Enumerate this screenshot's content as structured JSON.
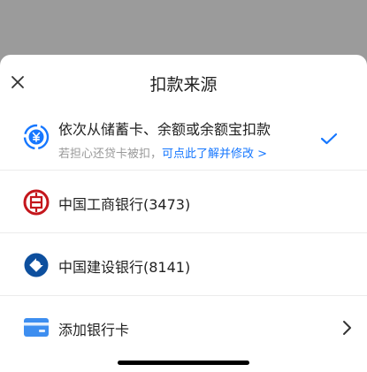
{
  "sheet": {
    "title": "扣款来源",
    "close_icon": "close-icon"
  },
  "sources": [
    {
      "id": "auto",
      "label": "依次从储蓄卡、余额或余额宝扣款",
      "sub_text": "若担心还贷卡被扣，",
      "sub_link": "可点此了解并修改 >",
      "icon": "yuan-coin-icon",
      "selected": true
    },
    {
      "id": "icbc",
      "label": "中国工商银行(3473)",
      "icon": "icbc-logo-icon"
    },
    {
      "id": "ccb",
      "label": "中国建设银行(8141)",
      "icon": "ccb-logo-icon"
    },
    {
      "id": "add",
      "label": "添加银行卡",
      "icon": "bank-card-icon"
    }
  ],
  "colors": {
    "accent": "#1677ff",
    "icbc_red": "#c4161c",
    "ccb_blue": "#0d4f9e",
    "card_blue": "#3d8ef0",
    "overlay": "#9b9b9b"
  }
}
